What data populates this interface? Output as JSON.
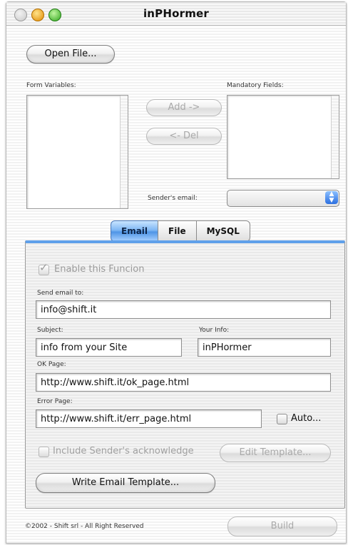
{
  "window": {
    "title": "inPHormer"
  },
  "buttons": {
    "open_file": "Open File...",
    "add": "Add ->",
    "del": "<- Del",
    "auto": "Auto...",
    "edit_template": "Edit Template...",
    "write_email_template": "Write Email Template...",
    "build": "Build"
  },
  "labels": {
    "form_variables": "Form Variables:",
    "mandatory_fields": "Mandatory Fields:",
    "senders_email": "Sender's email:",
    "send_email_to": "Send email to:",
    "subject": "Subject:",
    "your_info": "Your Info:",
    "ok_page": "OK Page:",
    "error_page": "Error Page:"
  },
  "tabs": [
    "Email",
    "File",
    "MySQL"
  ],
  "active_tab": "Email",
  "fields": {
    "send_email_to": "info@shift.it",
    "subject": "info from your Site",
    "your_info": "inPHormer",
    "ok_page": "http://www.shift.it/ok_page.html",
    "error_page": "http://www.shift.it/err_page.html",
    "senders_email": ""
  },
  "checkboxes": {
    "enable_function": {
      "label": "Enable this Funcion",
      "checked": true,
      "enabled": false
    },
    "include_ack": {
      "label": "Include Sender's acknowledge",
      "checked": false,
      "enabled": false
    },
    "auto": {
      "checked": false
    }
  },
  "footer": {
    "copyright": "©2002 - Shift srl - All Right Reserved"
  }
}
